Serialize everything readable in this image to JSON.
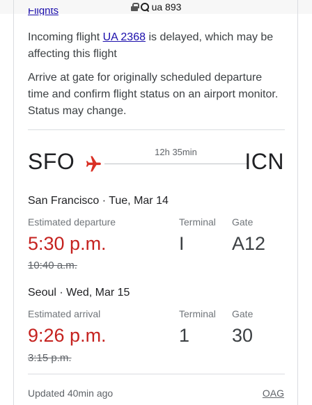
{
  "address_bar": {
    "query": "ua 893"
  },
  "card": {
    "cut_link": "Flights",
    "notice1": {
      "before": "Incoming flight ",
      "link": "UA 2368",
      "after": " is delayed, which may be affecting this flight"
    },
    "notice2": "Arrive at gate for originally scheduled departure time and confirm flight status on an airport monitor. Status may change.",
    "route": {
      "from": "SFO",
      "to": "ICN",
      "duration": "12h 35min"
    },
    "departure": {
      "city_date": "San Francisco · Tue, Mar 14",
      "time_label": "Estimated departure",
      "terminal_label": "Terminal",
      "gate_label": "Gate",
      "time": "5:30 p.m.",
      "terminal": "I",
      "gate": "A12",
      "scheduled": "10:40 a.m."
    },
    "arrival": {
      "city_date": "Seoul · Wed, Mar 15",
      "time_label": "Estimated arrival",
      "terminal_label": "Terminal",
      "gate_label": "Gate",
      "time": "9:26 p.m.",
      "terminal": "1",
      "gate": "30",
      "scheduled": "3:15 p.m."
    },
    "footer": {
      "updated": "Updated 40min ago",
      "source": "OAG"
    }
  },
  "colors": {
    "delay_red": "#c5221f",
    "link_blue": "#1a0dab",
    "plane_red": "#d93025"
  }
}
